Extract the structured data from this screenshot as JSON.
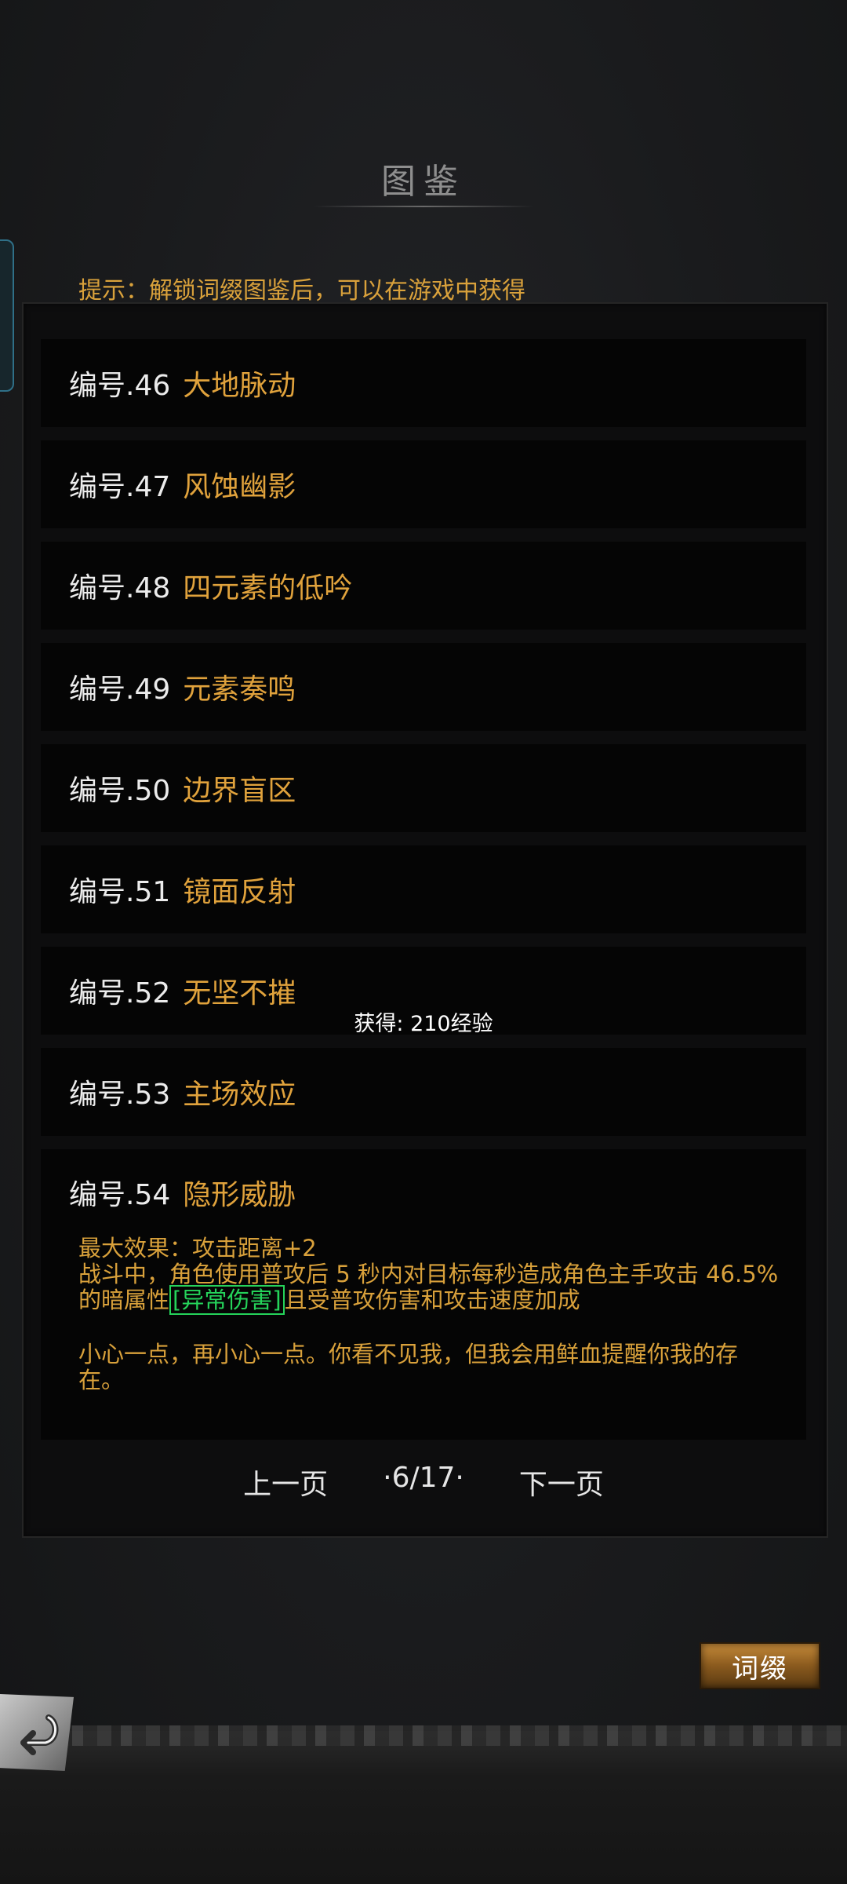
{
  "header": {
    "title": "图鉴"
  },
  "hint": "提示：解锁词缀图鉴后，可以在游戏中获得",
  "entries": [
    {
      "num": "编号.46",
      "name": "大地脉动"
    },
    {
      "num": "编号.47",
      "name": "风蚀幽影"
    },
    {
      "num": "编号.48",
      "name": "四元素的低吟"
    },
    {
      "num": "编号.49",
      "name": "元素奏鸣"
    },
    {
      "num": "编号.50",
      "name": "边界盲区"
    },
    {
      "num": "编号.51",
      "name": "镜面反射"
    },
    {
      "num": "编号.52",
      "name": "无坚不摧"
    },
    {
      "num": "编号.53",
      "name": "主场效应"
    }
  ],
  "expanded": {
    "num": "编号.54",
    "name": "隐形威胁",
    "max_effect": "最大效果：攻击距离+2",
    "desc_part1": "战斗中，角色使用普攻后 5 秒内对目标每秒造成角色主手攻击 46.5% 的暗属性",
    "desc_tag": "[异常伤害]",
    "desc_part2": "且受普攻伤害和攻击速度加成",
    "flavor": "小心一点，再小心一点。你看不见我，但我会用鲜血提醒你我的存在。"
  },
  "reward": "获得: 210经验",
  "pager": {
    "prev": "上一页",
    "page": "·6/17·",
    "next": "下一页"
  },
  "buttons": {
    "affix": "词缀"
  }
}
